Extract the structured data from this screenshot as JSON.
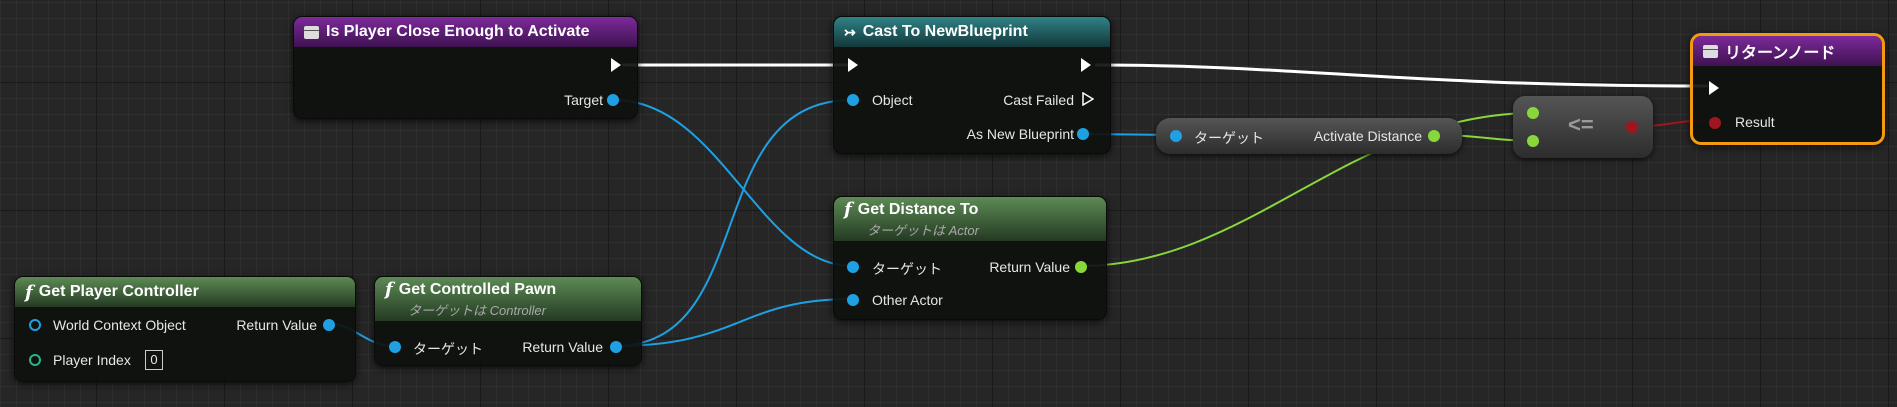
{
  "nodes": {
    "is_player_close": {
      "title": "Is Player Close Enough to Activate",
      "target_label": "Target"
    },
    "cast": {
      "title": "Cast To NewBlueprint",
      "object_label": "Object",
      "cast_failed_label": "Cast Failed",
      "as_label": "As New Blueprint"
    },
    "return_node": {
      "title": "リターンノード",
      "result_label": "Result"
    },
    "get_var": {
      "target_label": "ターゲット",
      "value_label": "Activate Distance"
    },
    "compare": {
      "operator": "<="
    },
    "get_distance": {
      "title": "Get Distance To",
      "subtitle": "ターゲットは Actor",
      "target_label": "ターゲット",
      "return_label": "Return Value",
      "other_label": "Other Actor"
    },
    "get_player_controller": {
      "title": "Get Player Controller",
      "world_label": "World Context Object",
      "return_label": "Return Value",
      "index_label": "Player Index",
      "index_value": "0"
    },
    "get_controlled_pawn": {
      "title": "Get Controlled Pawn",
      "subtitle": "ターゲットは Controller",
      "target_label": "ターゲット",
      "return_label": "Return Value"
    }
  },
  "colors": {
    "exec": "#ffffff",
    "object_pin": "#1fa0e3",
    "float_pin": "#88d83c",
    "bool_pin": "#a0161e",
    "struct_pin": "#28b38a",
    "selection": "#f39a11",
    "function_header": "#5d8a55",
    "event_header": "#7d2a9a",
    "cast_header": "#2f8286"
  }
}
